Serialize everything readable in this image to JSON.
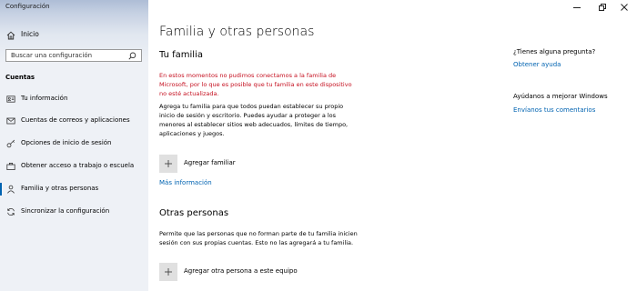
{
  "window": {
    "title": "Configuración"
  },
  "sidebar": {
    "home_label": "Inicio",
    "search_placeholder": "Buscar una configuración",
    "section_label": "Cuentas",
    "items": [
      {
        "label": "Tu información",
        "icon": "person-card-icon"
      },
      {
        "label": "Cuentas de correos y aplicaciones",
        "icon": "mail-icon"
      },
      {
        "label": "Opciones de inicio de sesión",
        "icon": "key-icon"
      },
      {
        "label": "Obtener acceso a trabajo o escuela",
        "icon": "briefcase-icon"
      },
      {
        "label": "Familia y otras personas",
        "icon": "person-icon",
        "selected": true
      },
      {
        "label": "Sincronizar la configuración",
        "icon": "sync-icon"
      }
    ]
  },
  "main": {
    "page_title": "Familia y otras personas",
    "family": {
      "heading": "Tu familia",
      "error_lines": [
        "En estos momentos no pudimos conectamos a la familia de",
        "Microsoft, por lo que es posible que tu familia en este dispositivo",
        "no esté actualizada."
      ],
      "description_lines": [
        "Agrega tu familia para que todos puedan establecer su propio",
        "inicio de sesión y escritorio. Puedes ayudar a proteger a los",
        "menores al establecer sitios web adecuados, límites de tiempo,",
        "aplicaciones y juegos."
      ],
      "add_label": "Agregar familiar",
      "more_info": "Más información"
    },
    "others": {
      "heading": "Otras personas",
      "description_lines": [
        "Permite que las personas que no forman parte de tu familia inicien",
        "sesión con sus propias cuentas. Esto no las agregará a tu familia."
      ],
      "add_label": "Agregar otra persona a este equipo"
    }
  },
  "right": {
    "question_heading": "¿Tienes alguna pregunta?",
    "help_link": "Obtener ayuda",
    "improve_heading": "Ayúdanos a mejorar Windows",
    "feedback_link": "Envíanos tus comentarios"
  },
  "colors": {
    "accent": "#0063b1",
    "error": "#c50f1f",
    "sidebar_bg": "#eef1f6"
  }
}
